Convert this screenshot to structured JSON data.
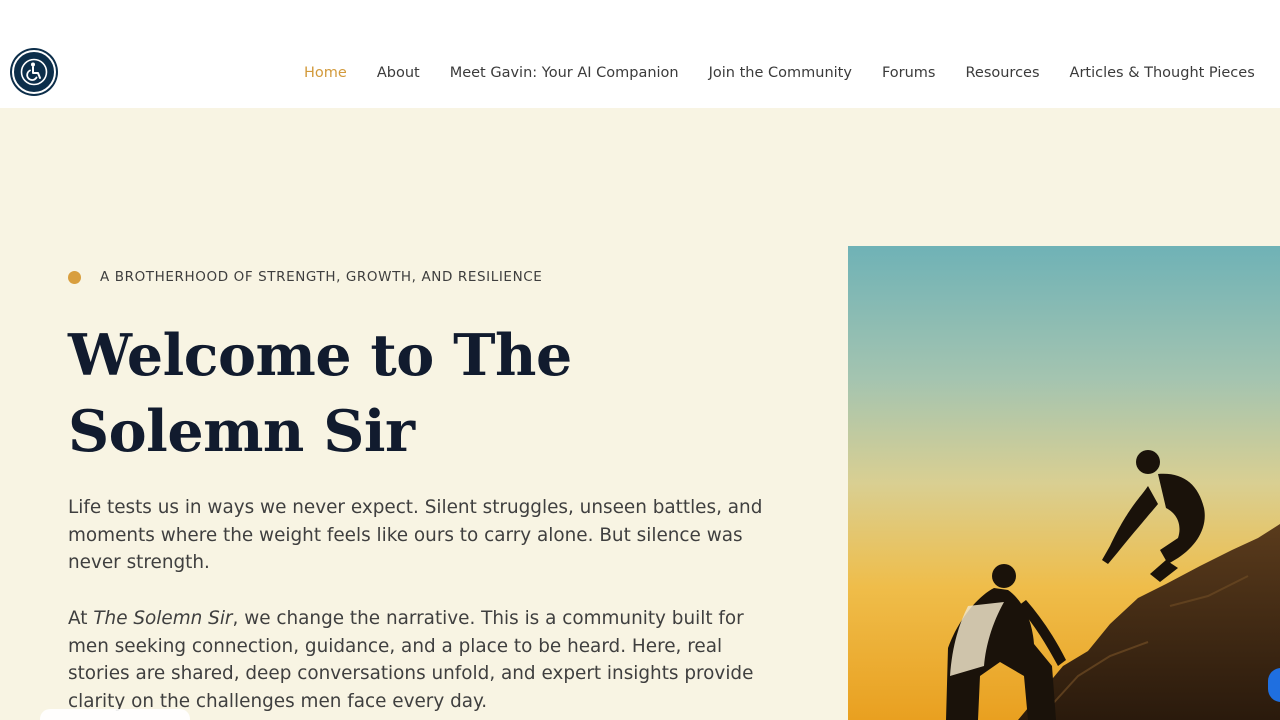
{
  "header": {
    "accessibility_icon": "wheelchair-accessibility-icon",
    "nav": [
      {
        "label": "Home",
        "active": true
      },
      {
        "label": "About",
        "active": false
      },
      {
        "label": "Meet Gavin: Your AI Companion",
        "active": false
      },
      {
        "label": "Join the Community",
        "active": false
      },
      {
        "label": "Forums",
        "active": false
      },
      {
        "label": "Resources",
        "active": false
      },
      {
        "label": "Articles & Thought Pieces",
        "active": false
      }
    ]
  },
  "hero": {
    "eyebrow": "A BROTHERHOOD OF STRENGTH, GROWTH, AND RESILIENCE",
    "title": "Welcome to The Solemn Sir",
    "para1": "Life tests us in ways we never expect. Silent struggles, unseen battles, and moments where the weight feels like ours to carry alone. But silence was never strength.",
    "para2_prefix": "At ",
    "para2_brand": "The Solemn Sir",
    "para2_rest": ", we change the narrative. This is a community built for men seeking connection, guidance, and a place to be heard. Here, real stories are shared, deep conversations unfold, and expert insights provide clarity on the challenges men face every day."
  },
  "colors": {
    "accent": "#d29a3c",
    "hero_bg": "#f8f4e3",
    "title": "#111b2e",
    "a11y_bg": "#0c2e4a"
  }
}
